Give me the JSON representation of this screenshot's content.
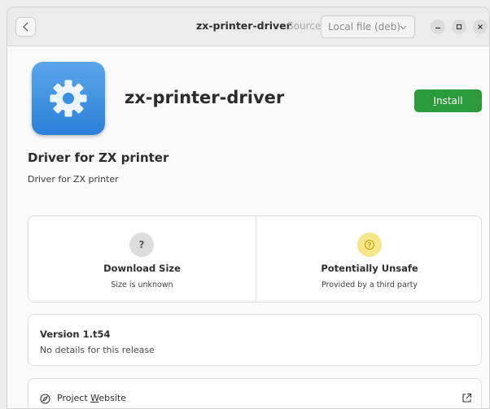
{
  "header": {
    "title": "zx-printer-driver",
    "source_label": "Source",
    "source_selected": "Local file (deb)"
  },
  "app": {
    "name": "zx-printer-driver",
    "install_label_prefix": "",
    "install_label_underlined": "I",
    "install_label_rest": "nstall",
    "summary": "Driver for ZX printer",
    "description": "Driver for ZX printer"
  },
  "tiles": [
    {
      "icon": "question-icon",
      "icon_text": "?",
      "title": "Download Size",
      "subtitle": "Size is unknown"
    },
    {
      "icon": "warning-icon",
      "title": "Potentially Unsafe",
      "subtitle": "Provided by a third party"
    }
  ],
  "version": {
    "title": "Version 1.t54",
    "details": "No details for this release"
  },
  "project_link": {
    "label_prefix": "Project ",
    "label_underlined": "W",
    "label_rest": "ebsite"
  },
  "colors": {
    "install": "#2b9a3a",
    "icon_blue": "#3b8fe0",
    "warning_bg": "#f6e68a",
    "warning_fg": "#c8a000"
  }
}
